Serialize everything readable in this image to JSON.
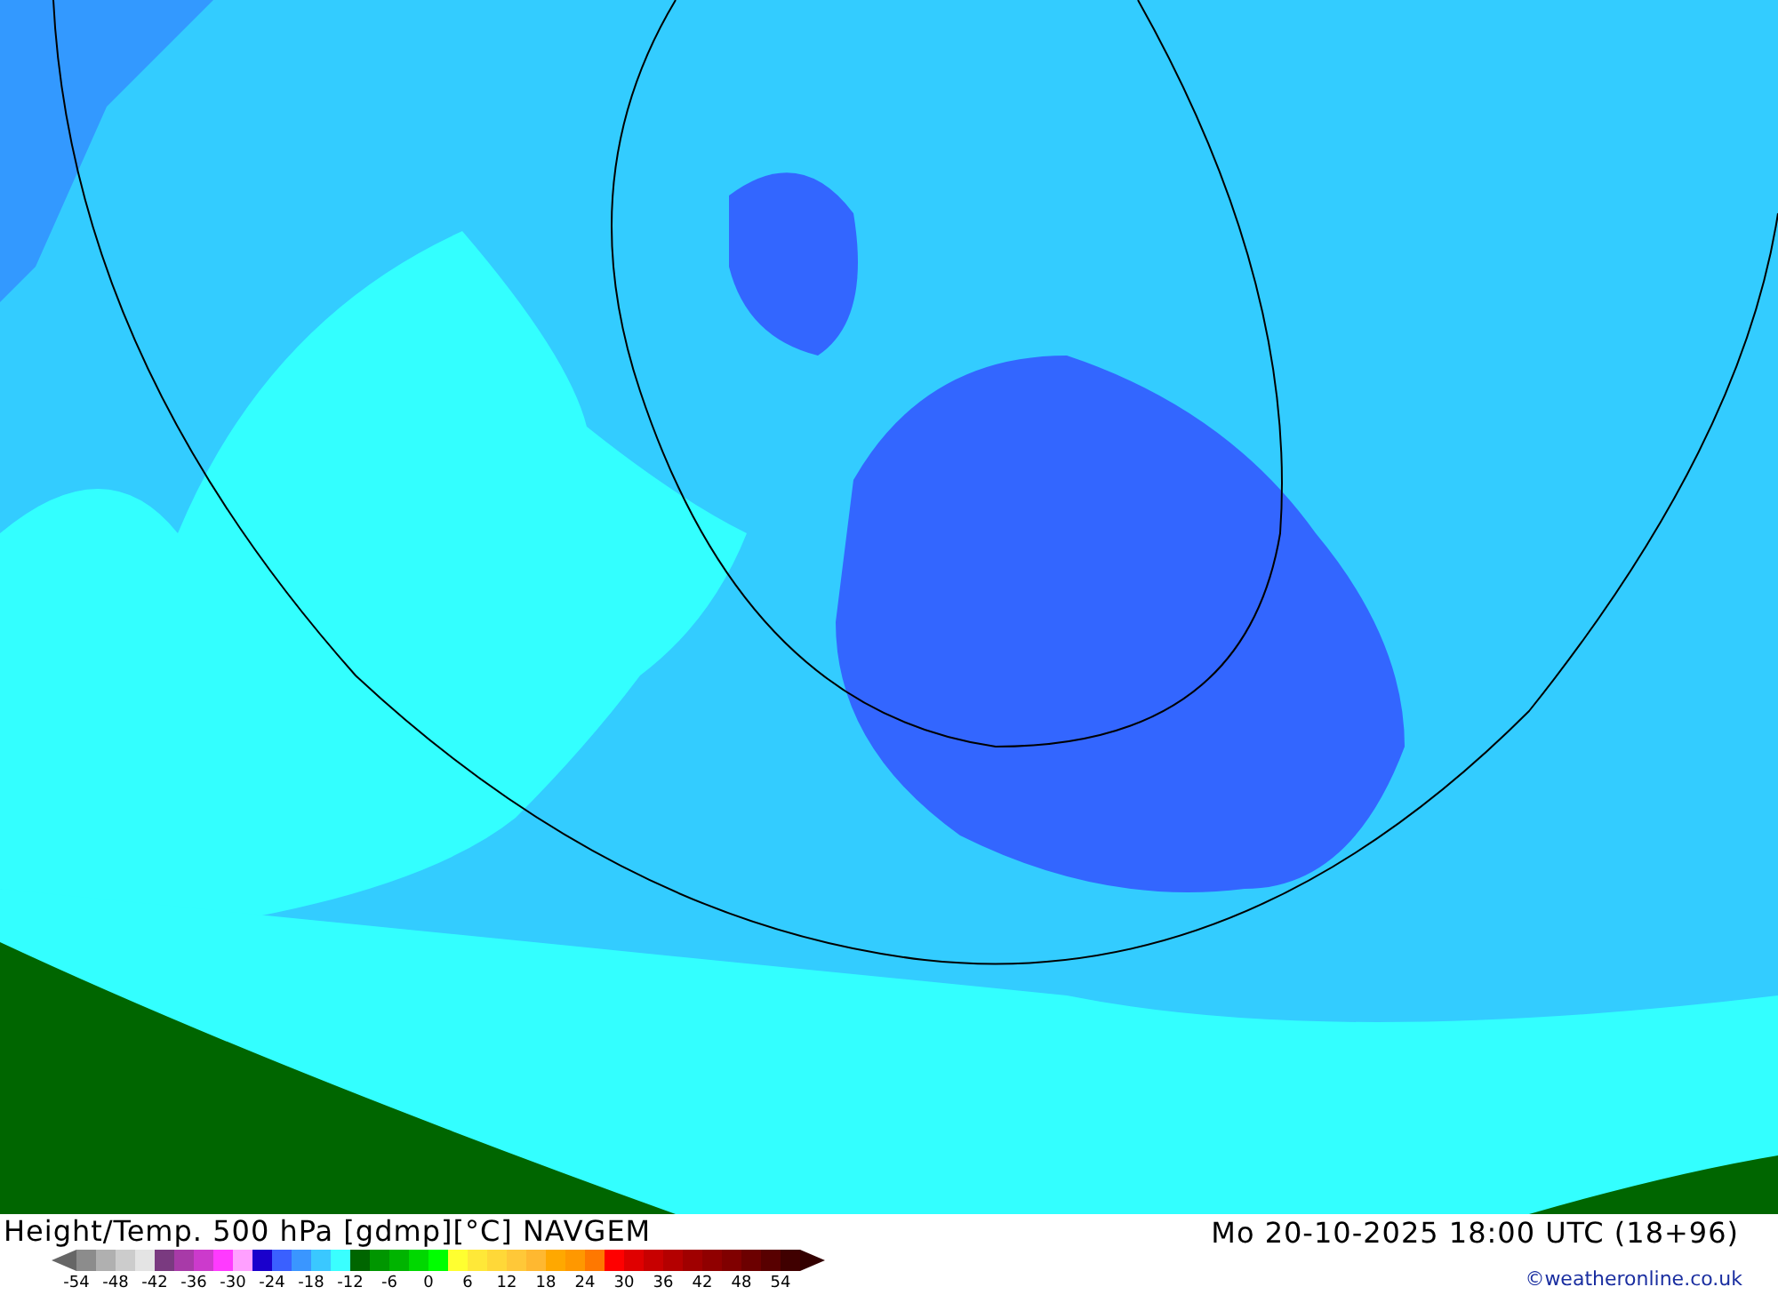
{
  "map_title": "Height/Temp. 500 hPa [gdmp][°C] NAVGEM",
  "valid_time": "Mo 20-10-2025 18:00 UTC (18+96)",
  "legend": {
    "swatches": [
      {
        "color": "#8c8c8c"
      },
      {
        "color": "#b0b0b0"
      },
      {
        "color": "#cccccc"
      },
      {
        "color": "#e4e4e4"
      },
      {
        "color": "#7a3a80"
      },
      {
        "color": "#a83aa8"
      },
      {
        "color": "#cc3acc"
      },
      {
        "color": "#ff3aff"
      },
      {
        "color": "#ffa0ff"
      },
      {
        "color": "#1a00cc"
      },
      {
        "color": "#3a60ff"
      },
      {
        "color": "#3a96ff"
      },
      {
        "color": "#3ac8ff"
      },
      {
        "color": "#3affff"
      },
      {
        "color": "#006600"
      },
      {
        "color": "#009600"
      },
      {
        "color": "#00b400"
      },
      {
        "color": "#00d800"
      },
      {
        "color": "#00ff00"
      },
      {
        "color": "#ffff30"
      },
      {
        "color": "#ffe838"
      },
      {
        "color": "#ffd838"
      },
      {
        "color": "#ffc838"
      },
      {
        "color": "#ffb830"
      },
      {
        "color": "#ffa800"
      },
      {
        "color": "#ff9800"
      },
      {
        "color": "#ff7800"
      },
      {
        "color": "#ff0000"
      },
      {
        "color": "#e00000"
      },
      {
        "color": "#c80000"
      },
      {
        "color": "#b40000"
      },
      {
        "color": "#a00000"
      },
      {
        "color": "#900000"
      },
      {
        "color": "#800000"
      },
      {
        "color": "#6c0000"
      },
      {
        "color": "#580000"
      },
      {
        "color": "#400000"
      }
    ],
    "ticks": [
      "-54",
      "-48",
      "-42",
      "-36",
      "-30",
      "-24",
      "-18",
      "-12",
      "-6",
      "0",
      "6",
      "12",
      "18",
      "24",
      "30",
      "36",
      "42",
      "48",
      "54"
    ]
  },
  "credit": "©weatheronline.co.uk"
}
